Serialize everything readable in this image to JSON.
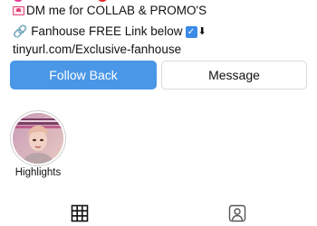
{
  "bio": {
    "collab_line": "DM me for COLLAB & PROMO'S",
    "fanhouse_line": "Fanhouse FREE Link below",
    "link": "tinyurl.com/Exclusive-fanhouse",
    "icons": [
      "love-letter-icon",
      "link-icon",
      "check-mark-button-icon",
      "down-arrow-icon"
    ]
  },
  "actions": {
    "follow_back": "Follow Back",
    "message": "Message"
  },
  "highlights": [
    {
      "label": "Highlights"
    }
  ],
  "tabs": [
    {
      "name": "posts",
      "icon": "grid-icon",
      "active": true
    },
    {
      "name": "tagged",
      "icon": "tagged-person-icon",
      "active": false
    }
  ],
  "colors": {
    "accent": "#4a97e8",
    "text": "#111111",
    "border": "#d9d9d9"
  }
}
